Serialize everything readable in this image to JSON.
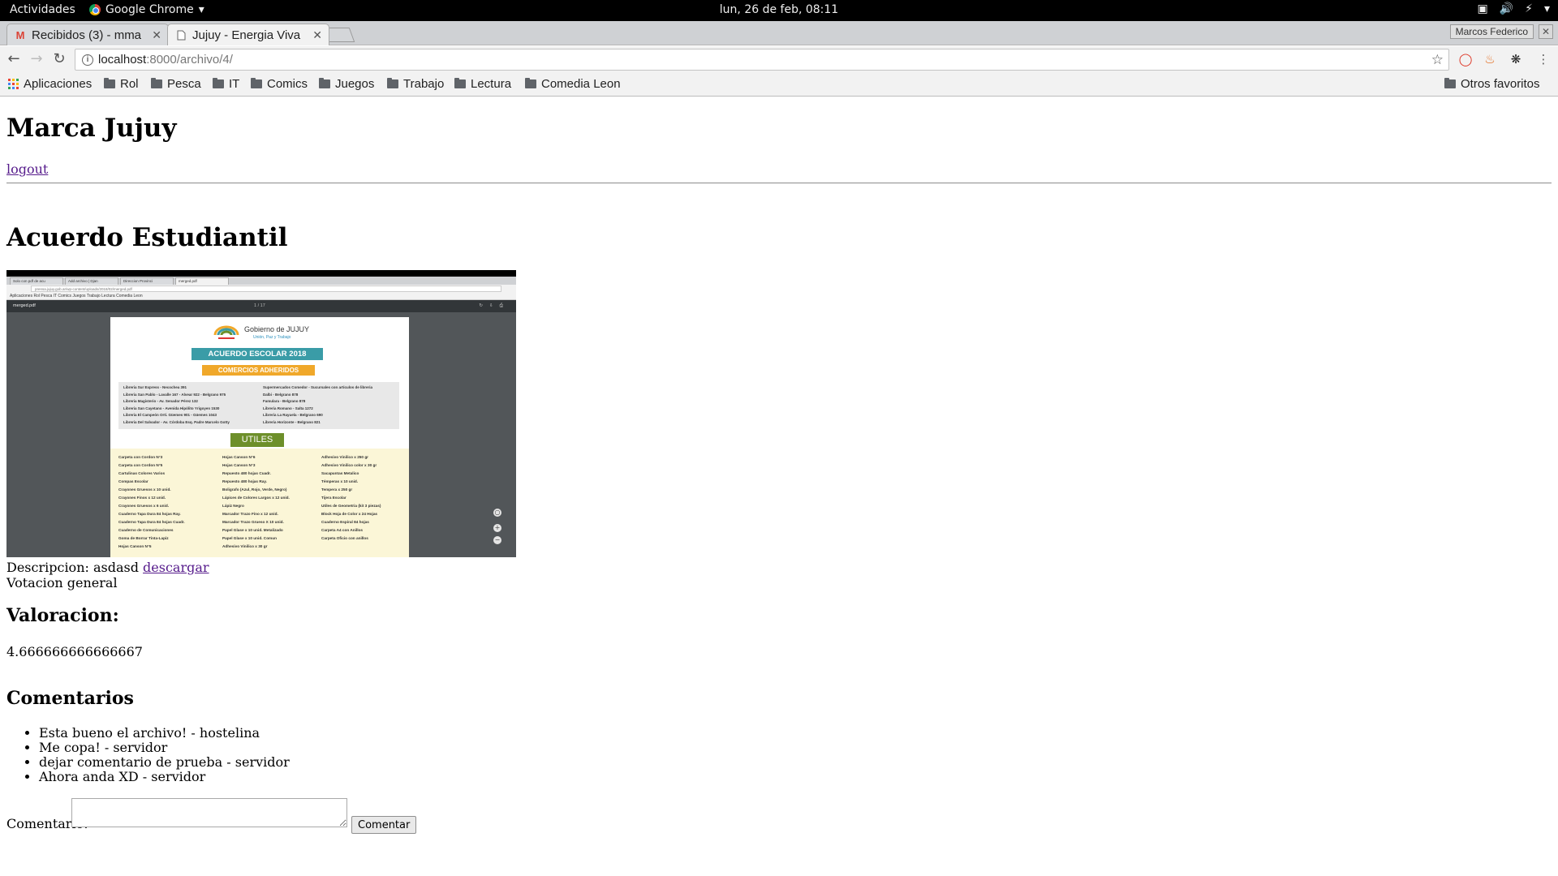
{
  "system": {
    "activities": "Actividades",
    "app_name": "Google Chrome",
    "clock": "lun, 26 de feb, 08:11"
  },
  "browser": {
    "tabs": [
      {
        "title": "Recibidos (3) - mma",
        "icon": "gmail-icon"
      },
      {
        "title": "Jujuy - Energia Viva",
        "icon": "page-icon"
      }
    ],
    "profile": "Marcos Federico",
    "url_host": "localhost",
    "url_path": ":8000/archivo/4/",
    "bookmarks": [
      "Aplicaciones",
      "Rol",
      "Pesca",
      "IT",
      "Comics",
      "Juegos",
      "Trabajo",
      "Lectura",
      "Comedia Leon"
    ],
    "other_bookmarks": "Otros favoritos"
  },
  "page": {
    "site_title": "Marca Jujuy",
    "logout": "logout",
    "file_title": "Acuerdo Estudiantil",
    "description_label": "Descripcion: asdasd",
    "download": "descargar",
    "voting": "Votacion general",
    "rating_heading": "Valoracion:",
    "rating_value": "4.666666666666667",
    "comments_heading": "Comentarios",
    "comments": [
      "Esta bueno el archivo! - hostelina",
      "Me copa! - servidor",
      "dejar comentario de prueba - servidor",
      "Ahora anda XD - servidor"
    ],
    "comment_label": "Comentario:",
    "comment_value": "",
    "submit": "Comentar"
  },
  "thumbnail": {
    "pdf_filename": "merged.pdf",
    "page_counter": "1 / 17",
    "mini_tabs": [
      "Solo con pdf de acu",
      "Add archivo | Djan",
      "Direccion Provinci",
      "merged.pdf"
    ],
    "mini_url": "prensa.jujuy.gob.ar/wp-content/uploads/2018/02/merged.pdf",
    "mini_bookmarks": "Aplicaciones  Rol  Pesca  IT  Comics  Juegos  Trabajo  Lectura  Comedia Leon",
    "gov_name": "Gobierno de JUJUY",
    "gov_motto": "Unión, Paz y Trabajo",
    "banner": "ACUERDO ESCOLAR 2018",
    "subbanner": "COMERCIOS ADHERIDOS",
    "stores_left": "Libreria Sur Express - Necochea 391\nLibreria San Pablo - Lavalle 167 - Alvear 922 - Belgrano 975\nLibreria Magisterio - Av. Senador Pérez 132\nLibreria San Cayetano - Avenida Hipólito Yrigoyen 1530\nLibreria El Campeón Ortí. Güemes 901 - Güemes 1043\nLibreria Del Salvador - Av. Córdoba Esq. Padre Marcelo Gotty",
    "stores_right": "Supermercados Comedor - Sucursales con articulos de libreria\nDalbi - Belgrano 878\nFamulara - Belgrano 878\nLibreria Romano - Salta 1272\nLibreria La Rayuela - Belgrano 690\nLibreria Horizonte - Belgrano 821",
    "section": "UTILES",
    "col1": "Carpeta con Cordon N°3\nCarpeta con Cordon N°5\nCartulinas Colores Varios\nCompas Escolar\nCrayones Gruesos x 10 unid.\nCrayones Finos x 12 unid.\nCrayones Gruesos x 6 unid.\nCuaderno Tapa Dura 84 hojas Ray.\nCuaderno Tapa Dura 84 hojas Cuadr.\nCuaderno de Comunicaciones\nGoma de Borrar Tinta-Lapiz\nHojas Canson N°5",
    "col2": "Hojas Canson N°6\nHojas Canson N°3\nRepuesto 480 hojas Cuadr.\nRepuesto 480 hojas Ray.\nBoligrafo (Azul, Rojo, Verde, Negro)\nLápices de Colores Largos x 12 unid.\nLápiz Negro\nMarcador Trazo Fino x 12 unid.\nMarcador Trazo Grueso X 10 unid.\nPapel Glase x 10 unid. Metalizado\nPapel Glase x 10 unid. Comun\nAdhesivo Vinilico x 30 gr",
    "col3": "Adhesivo Vinilico x 250 gr\nAdhesivo Vinilico color x 30 gr\nSacapuntas Metalico\nTémperas x 10 unid.\nTempera x 250 gr\nTijera Escolar\nUtiles de Geometria (kit 3 piezas)\nBlock Hoja de Color x 24 Hojas\nCuaderno Espiral 84 hojas\nCarpeta A4 con Anillos\nCarpeta Oficio con anillos"
  }
}
